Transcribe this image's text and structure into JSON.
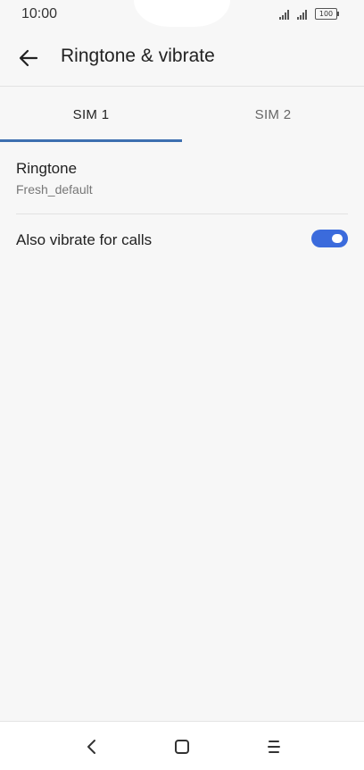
{
  "status_bar": {
    "time": "10:00",
    "battery": "100"
  },
  "app_bar": {
    "title": "Ringtone & vibrate",
    "back_icon": "arrow-left-icon"
  },
  "tabs": [
    {
      "label": "SIM 1",
      "active": true
    },
    {
      "label": "SIM 2",
      "active": false
    }
  ],
  "settings": {
    "ringtone": {
      "title": "Ringtone",
      "value": "Fresh_default"
    },
    "vibrate": {
      "label": "Also vibrate for calls",
      "enabled": true
    }
  },
  "nav_bar": {
    "icons": [
      "nav-back-icon",
      "nav-home-icon",
      "nav-menu-icon"
    ]
  },
  "colors": {
    "accent": "#3d6fb0",
    "toggle_on": "#3b6bdc",
    "background": "#f7f7f7"
  }
}
